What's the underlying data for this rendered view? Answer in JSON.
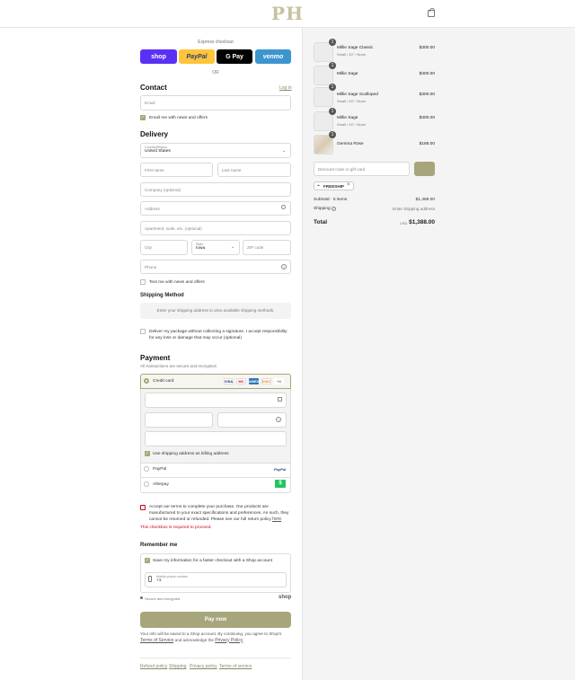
{
  "brand": {
    "logo_text": "PH"
  },
  "express": {
    "label": "Express checkout",
    "buttons": [
      "shop",
      "PayPal",
      "G Pay",
      "venmo"
    ],
    "or": "OR"
  },
  "contact": {
    "heading": "Contact",
    "login": "Log in",
    "email_placeholder": "Email",
    "email_news": "Email me with news and offers"
  },
  "delivery": {
    "heading": "Delivery",
    "country_label": "Country/Region",
    "country_value": "United States",
    "first_name": "First name",
    "last_name": "Last name",
    "company": "Company (optional)",
    "address": "Address",
    "apartment": "Apartment, suite, etc. (optional)",
    "city": "City",
    "state_label": "State",
    "state_value": "Iowa",
    "zip": "ZIP code",
    "phone": "Phone",
    "text_news": "Text me with news and offers"
  },
  "shipping_method": {
    "heading": "Shipping Method",
    "notice": "Enter your shipping address to view available shipping methods.",
    "signature_text": "Deliver my package without collecting a signature. I accept responsibility for any loss or damage that may occur (optional)"
  },
  "payment": {
    "heading": "Payment",
    "subtitle": "All transactions are secure and encrypted.",
    "credit_card": "Credit card",
    "card_brands": [
      "VISA",
      "MC",
      "AMEX",
      "DISC",
      "+4"
    ],
    "billing_same": "Use shipping address as billing address",
    "paypal": "PayPal",
    "paypal_logo": "PayPal",
    "afterpay": "Afterpay",
    "afterpay_logo": "$"
  },
  "terms": {
    "text": "Accept our terms to complete your purchase. Our products are manufactured to your exact specifications and preferences. As such, they cannot be returned or refunded. Please see our full return policy",
    "link": "here",
    "error": "This checkbox is required to proceed."
  },
  "remember": {
    "heading": "Remember me",
    "save_info": "Save my information for a faster checkout with a Shop account",
    "mobile_label": "Mobile phone number",
    "mobile_value": "+1",
    "secure": "Secure and encrypted",
    "shop": "shop"
  },
  "pay_now": "Pay now",
  "disclaimer": {
    "text": "Your info will be saved to a Shop account. By continuing, you agree to Shop's",
    "terms": "Terms of Service",
    "mid": "and acknowledge the",
    "privacy": "Privacy Policy"
  },
  "footer_links": [
    "Refund policy",
    "Shipping",
    "Privacy policy",
    "Terms of service"
  ],
  "order": {
    "items": [
      {
        "qty": "1",
        "name": "Millie Sage Classic",
        "variant": "Small / 10\" / None",
        "price": "$300.00"
      },
      {
        "qty": "1",
        "name": "Millie Sage",
        "variant": "",
        "price": "$300.00"
      },
      {
        "qty": "1",
        "name": "Millie Sage Scalloped",
        "variant": "Small / 10\" / None",
        "price": "$300.00"
      },
      {
        "qty": "1",
        "name": "Millie Sage",
        "variant": "Small / 10\" / None",
        "price": "$300.00"
      },
      {
        "qty": "1",
        "name": "Gemma Rose",
        "variant": "",
        "price": "$188.00"
      }
    ],
    "discount_placeholder": "Discount code or gift card",
    "code": "FREESHIP",
    "subtotal_label": "Subtotal · 5 items",
    "subtotal_value": "$1,388.00",
    "shipping_label": "Shipping",
    "shipping_value": "Enter shipping address",
    "total_label": "Total",
    "currency": "USD",
    "total_value": "$1,388.00"
  },
  "colors": {
    "accent": "#a7a57b",
    "shop": "#5a31f4",
    "paypal": "#ffc439",
    "gpay": "#000000",
    "venmo": "#3d95ce",
    "error": "#d0021b"
  }
}
